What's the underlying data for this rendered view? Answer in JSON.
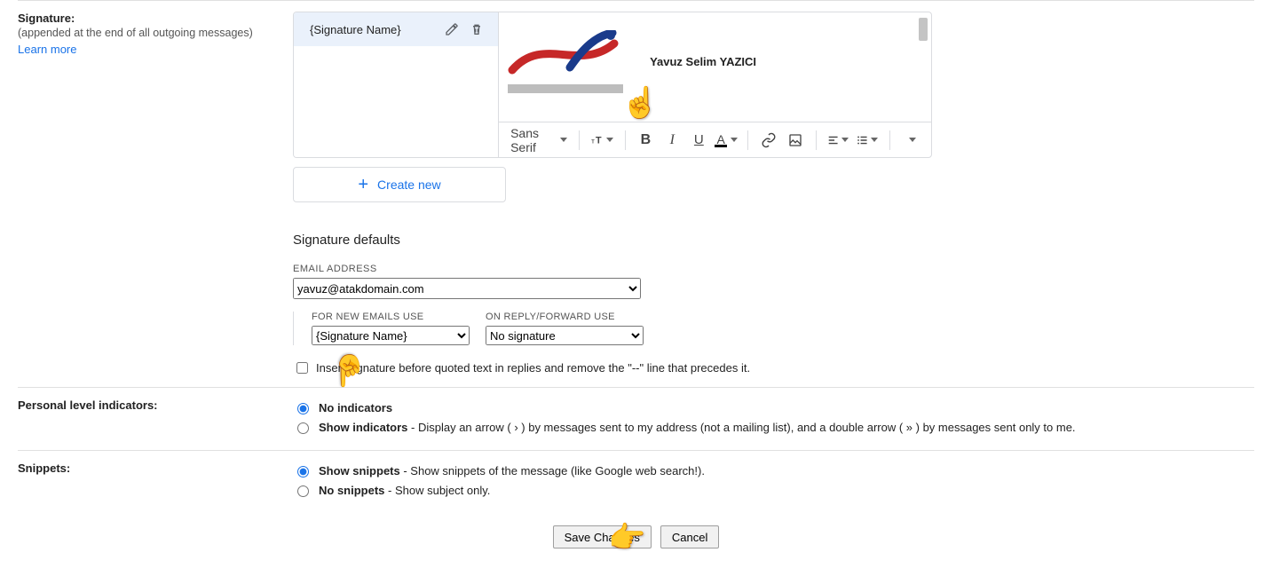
{
  "signature": {
    "heading": "Signature:",
    "subtext": "(appended at the end of all outgoing messages)",
    "learn_more": "Learn more",
    "list": [
      {
        "name": "{Signature Name}"
      }
    ],
    "preview_name": "Yavuz Selim YAZICI",
    "create_new": "Create new",
    "toolbar": {
      "font": "Sans Serif",
      "size": "тT",
      "bold": "B",
      "italic": "I",
      "underline": "U",
      "text_color": "A"
    },
    "defaults": {
      "title": "Signature defaults",
      "email_label": "EMAIL ADDRESS",
      "email_value": "yavuz@atakdomain.com",
      "for_new_label": "FOR NEW EMAILS USE",
      "for_new_value": "{Signature Name}",
      "on_reply_label": "ON REPLY/FORWARD USE",
      "on_reply_value": "No signature",
      "insert_checkbox": "Insert signature before quoted text in replies and remove the \"--\" line that precedes it."
    }
  },
  "personal_indicators": {
    "heading": "Personal level indicators:",
    "no_ind": "No indicators",
    "show_ind": "Show indicators",
    "show_ind_desc": " - Display an arrow ( › ) by messages sent to my address (not a mailing list), and a double arrow ( » ) by messages sent only to me."
  },
  "snippets": {
    "heading": "Snippets:",
    "show": "Show snippets",
    "show_desc": " - Show snippets of the message (like Google web search!).",
    "no": "No snippets",
    "no_desc": " - Show subject only."
  },
  "buttons": {
    "save": "Save Changes",
    "cancel": "Cancel"
  }
}
